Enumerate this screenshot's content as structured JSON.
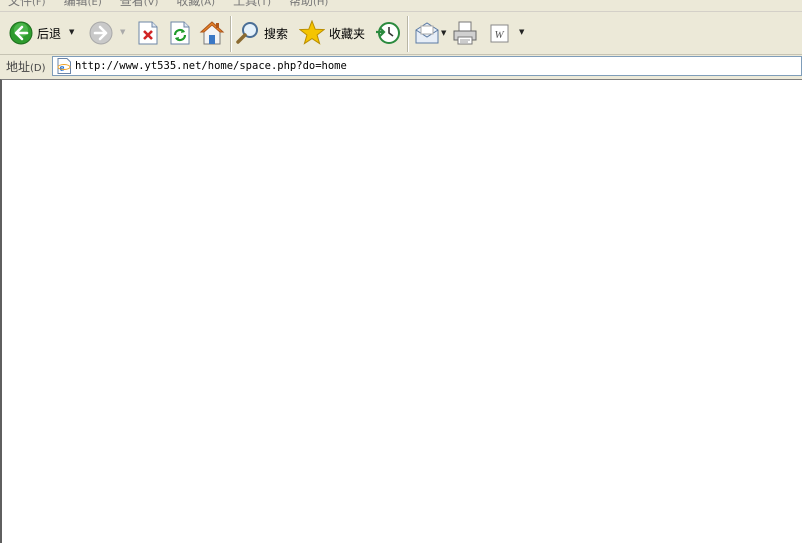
{
  "menu": [
    {
      "label": "文件",
      "hotkey": "(F)"
    },
    {
      "label": "编辑",
      "hotkey": "(E)"
    },
    {
      "label": "查看",
      "hotkey": "(V)"
    },
    {
      "label": "收藏",
      "hotkey": "(A)"
    },
    {
      "label": "工具",
      "hotkey": "(T)"
    },
    {
      "label": "帮助",
      "hotkey": "(H)"
    }
  ],
  "toolbar": {
    "back_label": "后退",
    "search_label": "搜索",
    "favorites_label": "收藏夹"
  },
  "address": {
    "label": "地址",
    "hotkey": "(D)",
    "url": "http://www.yt535.net/home/space.php?do=home"
  },
  "colors": {
    "chrome": "#ece9d8",
    "back_green": "#2e9b2e",
    "favorites_star": "#f5c400",
    "content_bg": "#ffffff"
  }
}
